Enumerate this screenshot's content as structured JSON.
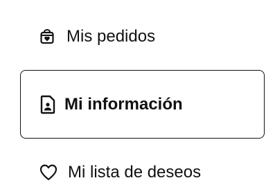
{
  "account_menu": {
    "items": [
      {
        "label": "Mis pedidos",
        "icon": "shopping-bag-heart-icon",
        "active": false
      },
      {
        "label": "Mi información",
        "icon": "user-document-icon",
        "active": true
      },
      {
        "label": "Mi lista de deseos",
        "icon": "heart-outline-icon",
        "active": false
      }
    ]
  },
  "colors": {
    "text": "#111111",
    "border": "#111111",
    "background": "#ffffff"
  }
}
